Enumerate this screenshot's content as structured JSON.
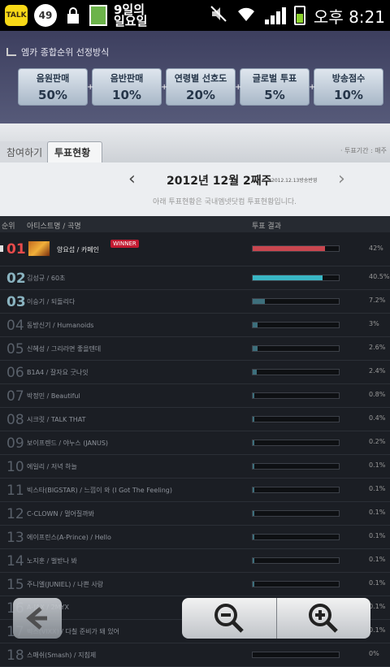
{
  "status_bar": {
    "talk_label": "TALK",
    "badge": "49",
    "day_text": "9일의\n일요일",
    "time": "오후 8:21",
    "icons": [
      "talk-icon",
      "lock-icon",
      "notes-icon",
      "mute-icon",
      "wifi-icon",
      "signal-icon",
      "battery-icon"
    ]
  },
  "criteria": {
    "title": "엠카 종합순위 선정방식",
    "items": [
      {
        "label": "음원판매",
        "percent": "50%"
      },
      {
        "label": "음반판매",
        "percent": "10%"
      },
      {
        "label": "연령별 선호도",
        "percent": "20%"
      },
      {
        "label": "글로벌 투표",
        "percent": "5%"
      },
      {
        "label": "방송점수",
        "percent": "10%"
      }
    ]
  },
  "tabs": {
    "join": "참여하기",
    "status": "투표현황",
    "period": "· 투표기간 : 매주"
  },
  "week": {
    "title": "2012년 12월 2째주",
    "sub": "2012.12.13방송반영",
    "note": "아래 투표현황은 국내엠넷닷컴 투표현황입니다."
  },
  "table_header": {
    "rank": "순위",
    "artist": "아티스트명 / 곡명",
    "result": "투표 결과"
  },
  "winner_label": "WINNER",
  "rows": [
    {
      "rank": "01",
      "song": "양요섭 / 카페인",
      "percent": "42%",
      "value": 42
    },
    {
      "rank": "02",
      "song": "김성규 / 60초",
      "percent": "40.5%",
      "value": 40.5
    },
    {
      "rank": "03",
      "song": "이승기 / 되돌리다",
      "percent": "7.2%",
      "value": 7.2
    },
    {
      "rank": "04",
      "song": "동방신기 / Humanoids",
      "percent": "3%",
      "value": 3
    },
    {
      "rank": "05",
      "song": "신혜성 / 그리라면 좋을텐데",
      "percent": "2.6%",
      "value": 2.6
    },
    {
      "rank": "06",
      "song": "B1A4 / 잘자요 굿나잇",
      "percent": "2.4%",
      "value": 2.4
    },
    {
      "rank": "07",
      "song": "박정민 / Beautiful",
      "percent": "0.8%",
      "value": 0.8
    },
    {
      "rank": "08",
      "song": "시크릿 / TALK THAT",
      "percent": "0.4%",
      "value": 0.4
    },
    {
      "rank": "09",
      "song": "보이프렌드 / 야누스 (JANUS)",
      "percent": "0.2%",
      "value": 0.2
    },
    {
      "rank": "10",
      "song": "에일리 / 저녁 하늘",
      "percent": "0.1%",
      "value": 0.1
    },
    {
      "rank": "11",
      "song": "빅스타(BIGSTAR) / 느낌이 와 (I Got The Feeling)",
      "percent": "0.1%",
      "value": 0.1
    },
    {
      "rank": "12",
      "song": "C-CLOWN / 멀어질까봐",
      "percent": "0.1%",
      "value": 0.1
    },
    {
      "rank": "13",
      "song": "에이프린스(A-Prince) / Hello",
      "percent": "0.1%",
      "value": 0.1
    },
    {
      "rank": "14",
      "song": "노지훈 / 벌받나 봐",
      "percent": "0.1%",
      "value": 0.1
    },
    {
      "rank": "15",
      "song": "주니엘(JUNIEL) / 나쁜 사랑",
      "percent": "0.1%",
      "value": 0.1
    },
    {
      "rank": "16",
      "song": "A-JAX / 2MYX",
      "percent": "0.1%",
      "value": 0.1
    },
    {
      "rank": "17",
      "song": "빅스(VIXX) / 다칠 준비가 돼 있어",
      "percent": "0.1%",
      "value": 0.1
    },
    {
      "rank": "18",
      "song": "스매쉬(Smash) / 지침제",
      "percent": "0%",
      "value": 0
    }
  ],
  "colors": {
    "rank1_bar": "#c9464f",
    "rank2_bar": "#39b6c4",
    "other_bar": "#3d6f7c"
  },
  "controls": {
    "back": "back-arrow-icon",
    "zoom_out": "zoom-out-icon",
    "zoom_in": "zoom-in-icon"
  }
}
